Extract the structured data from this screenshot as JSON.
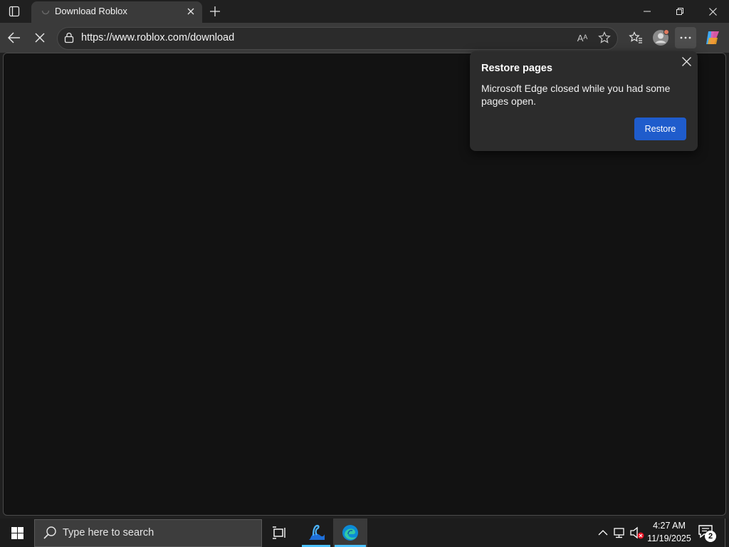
{
  "browser": {
    "tab": {
      "title": "Download Roblox",
      "favicon": "loading-spinner-icon"
    },
    "address_bar": {
      "url": "https://www.roblox.com/download"
    },
    "toolbar_icons": [
      "back-arrow-icon",
      "stop-icon",
      "lock-icon",
      "read-aloud-icon",
      "star-icon",
      "favorites-icon",
      "profile-icon",
      "more-icon",
      "copilot-icon"
    ],
    "window_controls": [
      "minimize-icon",
      "restore-icon",
      "close-icon"
    ]
  },
  "popup": {
    "title": "Restore pages",
    "message": "Microsoft Edge closed while you had some pages open.",
    "button_label": "Restore",
    "button_color": "#1f5ccc"
  },
  "taskbar": {
    "search_placeholder": "Type here to search",
    "apps": [
      "task-view-icon",
      "swan-app-icon",
      "edge-icon"
    ],
    "clock": {
      "time": "4:27 AM",
      "date": "11/19/2025"
    },
    "notification_count": "2",
    "accent_color": "#4cc2ff"
  },
  "read_aloud_glyph": "Aᴬ"
}
